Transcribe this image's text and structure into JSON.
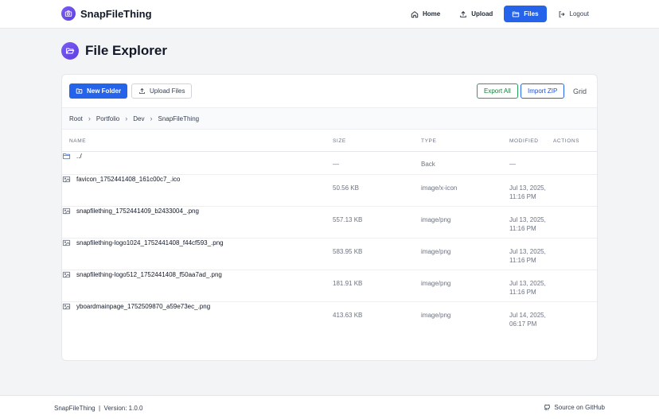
{
  "app": {
    "name": "SnapFileThing"
  },
  "nav": {
    "home": "Home",
    "upload": "Upload",
    "files": "Files",
    "logout": "Logout"
  },
  "page": {
    "title": "File Explorer"
  },
  "toolbar": {
    "new_folder": "New Folder",
    "upload_files": "Upload Files",
    "export_all": "Export All",
    "import_zip": "Import ZIP",
    "grid": "Grid"
  },
  "breadcrumb": [
    "Root",
    "Portfolio",
    "Dev",
    "SnapFileThing"
  ],
  "table": {
    "headers": {
      "name": "Name",
      "size": "Size",
      "type": "Type",
      "modified": "Modified",
      "actions": "Actions"
    },
    "parent": {
      "name": "../",
      "size": "—",
      "type": "Back",
      "modified": "—"
    },
    "rows": [
      {
        "name": "favicon_1752441408_161c00c7_.ico",
        "size": "50.56 KB",
        "type": "image/x-icon",
        "modified_date": "Jul 13, 2025,",
        "modified_time": "11:16 PM"
      },
      {
        "name": "snapfilething_1752441409_b2433004_.png",
        "size": "557.13 KB",
        "type": "image/png",
        "modified_date": "Jul 13, 2025,",
        "modified_time": "11:16 PM"
      },
      {
        "name": "snapfilething-logo1024_1752441408_f44cf593_.png",
        "size": "583.95 KB",
        "type": "image/png",
        "modified_date": "Jul 13, 2025,",
        "modified_time": "11:16 PM"
      },
      {
        "name": "snapfilething-logo512_1752441408_f50aa7ad_.png",
        "size": "181.91 KB",
        "type": "image/png",
        "modified_date": "Jul 13, 2025,",
        "modified_time": "11:16 PM"
      },
      {
        "name": "yboardmainpage_1752509870_a59e73ec_.png",
        "size": "413.63 KB",
        "type": "image/png",
        "modified_date": "Jul 14, 2025,",
        "modified_time": "06:17 PM"
      }
    ]
  },
  "footer": {
    "left": "SnapFileThing  |  Version: 1.0.0",
    "right": "Source on GitHub"
  },
  "colors": {
    "primary": "#2563eb",
    "brand": "#6d4ef0",
    "success": "#16a34a"
  },
  "icons": {
    "brand": "camera-icon",
    "home": "home-icon",
    "upload": "upload-icon",
    "files": "folder-icon",
    "logout": "logout-icon",
    "file": "image-file-icon",
    "github": "github-icon"
  }
}
